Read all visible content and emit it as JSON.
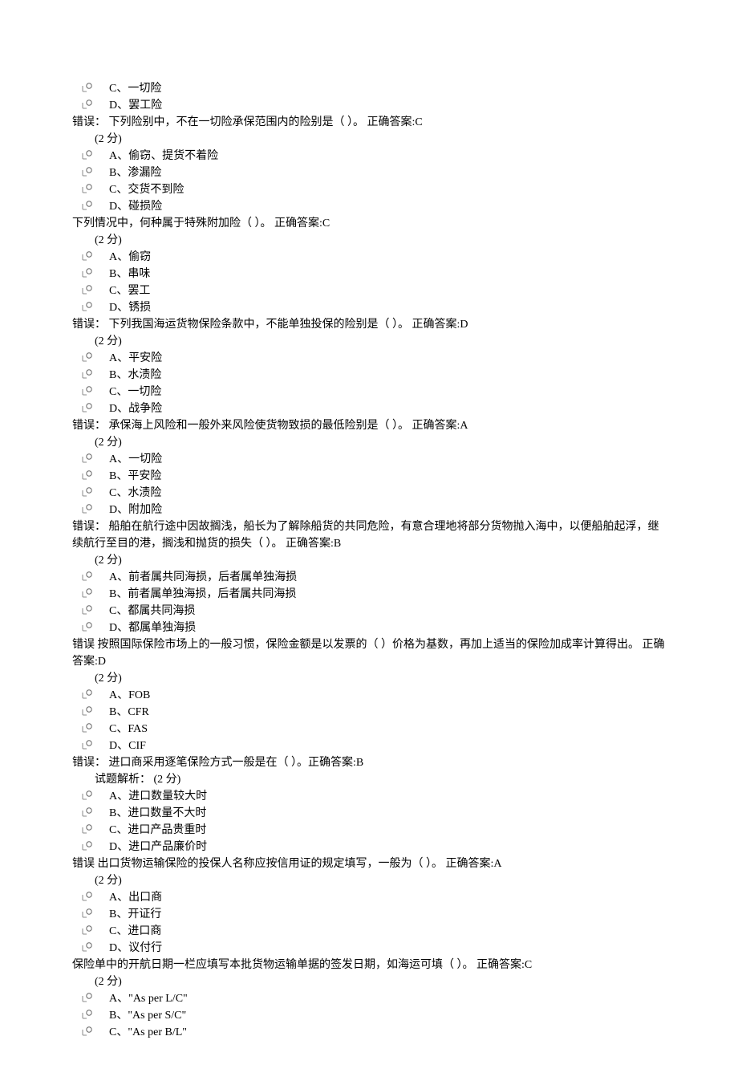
{
  "segments": [
    {
      "type": "option",
      "letter": "C",
      "text": "一切险"
    },
    {
      "type": "option",
      "letter": "D",
      "text": "罢工险"
    },
    {
      "type": "stem",
      "text": "错误：  下列险别中，不在一切险承保范围内的险别是（ ）。 正确答案:C"
    },
    {
      "type": "points",
      "text": "(2 分)"
    },
    {
      "type": "option",
      "letter": "A",
      "text": "偷窃、提货不着险"
    },
    {
      "type": "option",
      "letter": "B",
      "text": "渗漏险"
    },
    {
      "type": "option",
      "letter": "C",
      "text": "交货不到险"
    },
    {
      "type": "option",
      "letter": "D",
      "text": "碰损险"
    },
    {
      "type": "stem",
      "text": "下列情况中，何种属于特殊附加险（ ）。 正确答案:C"
    },
    {
      "type": "points",
      "text": "(2 分)"
    },
    {
      "type": "option",
      "letter": "A",
      "text": "偷窃"
    },
    {
      "type": "option",
      "letter": "B",
      "text": "串味"
    },
    {
      "type": "option",
      "letter": "C",
      "text": "罢工"
    },
    {
      "type": "option",
      "letter": "D",
      "text": "锈损"
    },
    {
      "type": "stem",
      "text": "错误：  下列我国海运货物保险条款中，不能单独投保的险别是（ ）。 正确答案:D"
    },
    {
      "type": "points",
      "text": "(2 分)"
    },
    {
      "type": "option",
      "letter": "A",
      "text": "平安险"
    },
    {
      "type": "option",
      "letter": "B",
      "text": "水渍险"
    },
    {
      "type": "option",
      "letter": "C",
      "text": "一切险"
    },
    {
      "type": "option",
      "letter": "D",
      "text": "战争险"
    },
    {
      "type": "stem",
      "text": "错误：  承保海上风险和一般外来风险使货物致损的最低险别是（ ）。 正确答案:A"
    },
    {
      "type": "points",
      "text": "(2 分)"
    },
    {
      "type": "option",
      "letter": "A",
      "text": "一切险"
    },
    {
      "type": "option",
      "letter": "B",
      "text": "平安险"
    },
    {
      "type": "option",
      "letter": "C",
      "text": "水渍险"
    },
    {
      "type": "option",
      "letter": "D",
      "text": "附加险"
    },
    {
      "type": "stem",
      "text": "错误：  船舶在航行途中因故搁浅，船长为了解除船货的共同危险，有意合理地将部分货物抛入海中，以便船舶起浮，继续航行至目的港，搁浅和抛货的损失（ ）。 正确答案:B"
    },
    {
      "type": "points",
      "text": "(2 分)"
    },
    {
      "type": "option",
      "letter": "A",
      "text": "前者属共同海损，后者属单独海损"
    },
    {
      "type": "option",
      "letter": "B",
      "text": "前者属单独海损，后者属共同海损"
    },
    {
      "type": "option",
      "letter": "C",
      "text": "都属共同海损"
    },
    {
      "type": "option",
      "letter": "D",
      "text": "都属单独海损"
    },
    {
      "type": "stem",
      "text": "错误    按照国际保险市场上的一般习惯，保险金额是以发票的（ ）价格为基数，再加上适当的保险加成率计算得出。 正确答案:D"
    },
    {
      "type": "points",
      "text": "(2 分)"
    },
    {
      "type": "option",
      "letter": "A",
      "text": "FOB"
    },
    {
      "type": "option",
      "letter": "B",
      "text": "CFR"
    },
    {
      "type": "option",
      "letter": "C",
      "text": "FAS"
    },
    {
      "type": "option",
      "letter": "D",
      "text": "CIF"
    },
    {
      "type": "stem",
      "text": "错误：  进口商采用逐笔保险方式一般是在（ ）。正确答案:B"
    },
    {
      "type": "points",
      "text": "试题解析：  (2 分)"
    },
    {
      "type": "option",
      "letter": "A",
      "text": "进口数量较大时"
    },
    {
      "type": "option",
      "letter": "B",
      "text": "进口数量不大时"
    },
    {
      "type": "option",
      "letter": "C",
      "text": "进口产品贵重时"
    },
    {
      "type": "option",
      "letter": "D",
      "text": "进口产品廉价时"
    },
    {
      "type": "stem",
      "text": "错误    出口货物运输保险的投保人名称应按信用证的规定填写，一般为（ ）。 正确答案:A"
    },
    {
      "type": "points",
      "text": "(2 分)"
    },
    {
      "type": "option",
      "letter": "A",
      "text": "出口商"
    },
    {
      "type": "option",
      "letter": "B",
      "text": "开证行"
    },
    {
      "type": "option",
      "letter": "C",
      "text": "进口商"
    },
    {
      "type": "option",
      "letter": "D",
      "text": "议付行"
    },
    {
      "type": "stem",
      "text": "保险单中的开航日期一栏应填写本批货物运输单据的签发日期，如海运可填（ ）。 正确答案:C"
    },
    {
      "type": "points",
      "text": "(2 分)"
    },
    {
      "type": "option",
      "letter": "A",
      "text": "\"As per L/C\""
    },
    {
      "type": "option",
      "letter": "B",
      "text": "\"As per S/C\""
    },
    {
      "type": "option",
      "letter": "C",
      "text": "\"As per B/L\""
    }
  ],
  "option_label_sep": "、"
}
